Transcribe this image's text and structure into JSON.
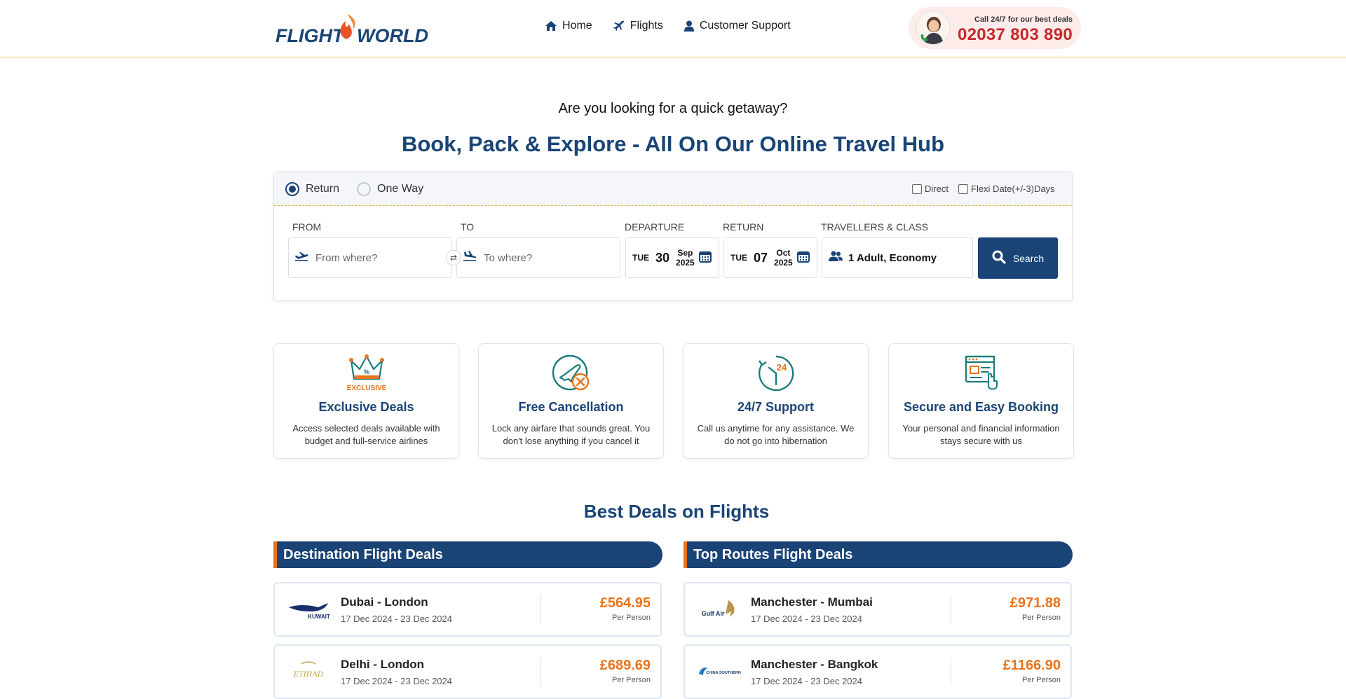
{
  "header": {
    "logo_text": "FLIGHT WORLD",
    "nav": [
      {
        "label": "Home",
        "icon": "home-icon"
      },
      {
        "label": "Flights",
        "icon": "plane-icon"
      },
      {
        "label": "Customer Support",
        "icon": "user-icon"
      }
    ],
    "call_label": "Call 24/7 for our best deals",
    "phone": "02037 803 890"
  },
  "hero": {
    "subtitle": "Are you looking for a quick getaway?",
    "title": "Book, Pack & Explore - All On Our Online Travel Hub"
  },
  "search": {
    "trip_types": [
      {
        "label": "Return",
        "selected": true
      },
      {
        "label": "One Way",
        "selected": false
      }
    ],
    "options": [
      {
        "label": "Direct",
        "checked": false
      },
      {
        "label": "Flexi Date(+/-3)Days",
        "checked": false
      }
    ],
    "from": {
      "label": "FROM",
      "placeholder": "From where?"
    },
    "to": {
      "label": "TO",
      "placeholder": "To where?"
    },
    "swap_glyph": "⇄",
    "departure": {
      "label": "DEPARTURE",
      "day": "TUE",
      "date": "30",
      "month": "Sep",
      "year": "2025"
    },
    "return": {
      "label": "RETURN",
      "day": "TUE",
      "date": "07",
      "month": "Oct",
      "year": "2025"
    },
    "travellers": {
      "label": "TRAVELLERS & CLASS",
      "value": "1 Adult, Economy"
    },
    "search_label": "Search"
  },
  "features": [
    {
      "title": "Exclusive Deals",
      "desc": "Access selected deals available with budget and full-service airlines",
      "icon": "crown-icon",
      "badge": "EXCLUSIVE"
    },
    {
      "title": "Free Cancellation",
      "desc": "Lock any airfare that sounds great. You don't lose anything if you cancel it",
      "icon": "plane-cancel-icon"
    },
    {
      "title": "24/7 Support",
      "desc": "Call us anytime for any assistance. We do not go into hibernation",
      "icon": "clock-24-icon",
      "badge": "24"
    },
    {
      "title": "Secure and Easy Booking",
      "desc": "Your personal and financial information stays secure with us",
      "icon": "secure-booking-icon"
    }
  ],
  "deals": {
    "title": "Best Deals on Flights",
    "destination": {
      "header": "Destination Flight Deals",
      "rows": [
        {
          "airline": "KUWAIT",
          "route": "Dubai - London",
          "dates": "17 Dec 2024 - 23 Dec 2024",
          "price": "£564.95",
          "per": "Per Person"
        },
        {
          "airline": "ETIHAD",
          "route": "Delhi - London",
          "dates": "17 Dec 2024 - 23 Dec 2024",
          "price": "£689.69",
          "per": "Per Person"
        }
      ]
    },
    "routes": {
      "header": "Top Routes Flight Deals",
      "rows": [
        {
          "airline": "Gulf Air",
          "route": "Manchester - Mumbai",
          "dates": "17 Dec 2024 - 23 Dec 2024",
          "price": "£971.88",
          "per": "Per Person"
        },
        {
          "airline": "CHINA SOUTHERN",
          "route": "Manchester - Bangkok",
          "dates": "17 Dec 2024 - 23 Dec 2024",
          "price": "£1166.90",
          "per": "Per Person"
        }
      ]
    }
  },
  "colors": {
    "brand_blue": "#1a4476",
    "accent_orange": "#e8731c",
    "phone_red": "#c8282c",
    "header_border": "#e8c65a"
  }
}
